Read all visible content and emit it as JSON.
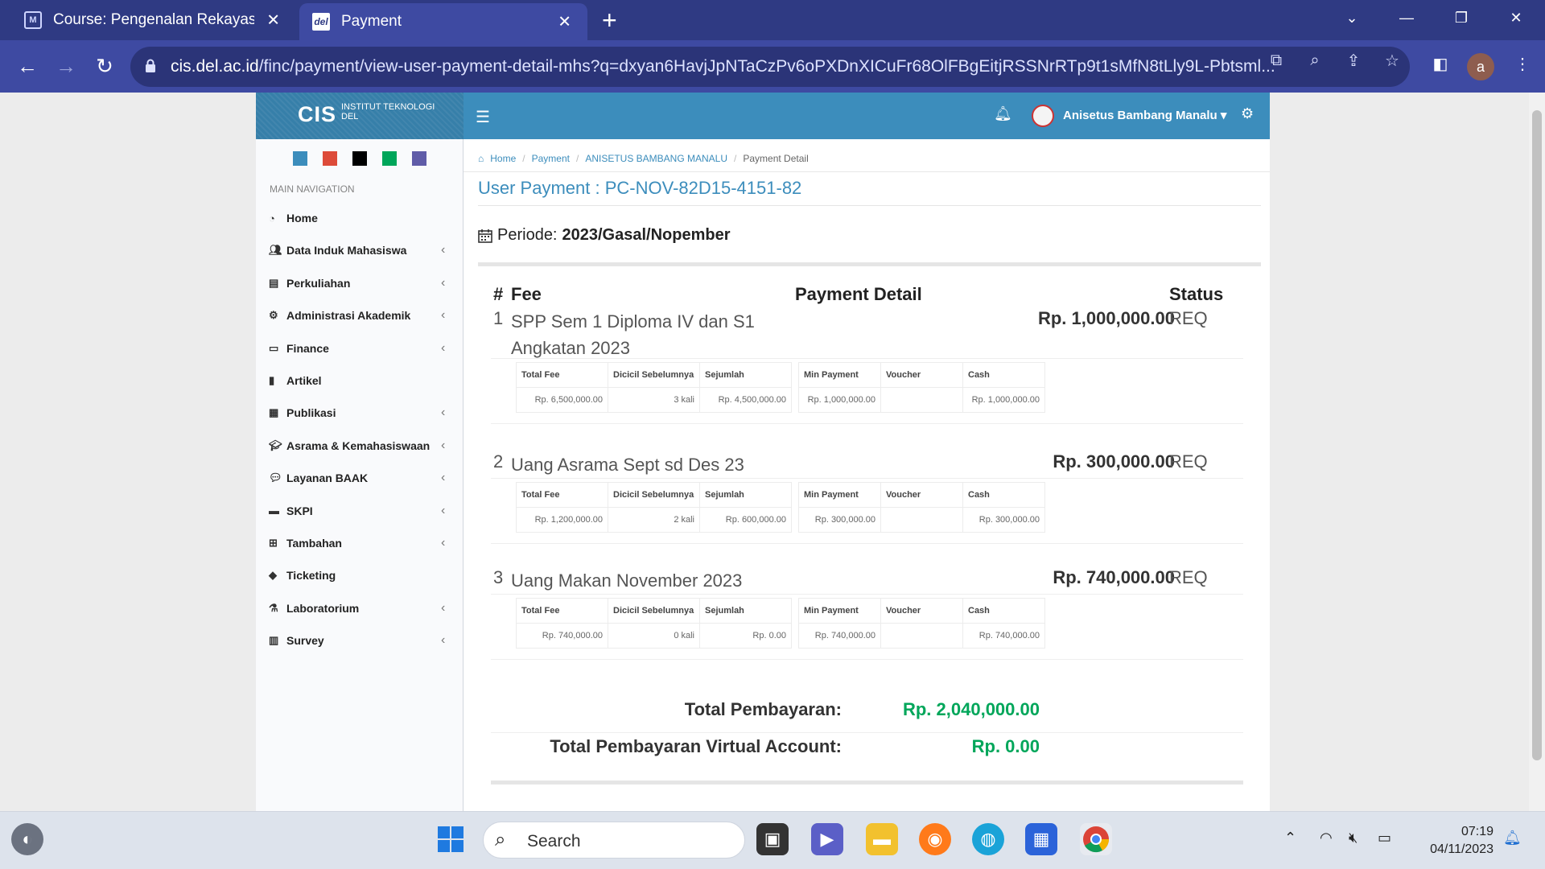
{
  "browser": {
    "tabs": [
      {
        "title": "Course: Pengenalan Rekayasa Pe",
        "icon": "moodle-icon"
      },
      {
        "title": "Payment",
        "icon": "del-icon"
      }
    ],
    "url_host": "cis.del.ac.id",
    "url_rest": "/finc/payment/view-user-payment-detail-mhs?q=dxyan6HavjJpNTaCzPv6oPXDnXICuFr68OlFBgEitjRSSNrRTp9t1sMfN8tLly9L-Pbtsml...",
    "profile_initial": "a"
  },
  "header": {
    "logo_main": "CIS",
    "logo_sub": "INSTITUT TEKNOLOGI DEL",
    "user_name": "Anisetus Bambang Manalu"
  },
  "sidebar": {
    "swatch_colors": [
      "#3c8dbc",
      "#dd4b39",
      "#000000",
      "#00a65a",
      "#605ca8"
    ],
    "nav_header": "MAIN NAVIGATION",
    "items": [
      {
        "label": "Home",
        "icon": "dashboard-icon",
        "expandable": false
      },
      {
        "label": "Data Induk Mahasiswa",
        "icon": "users-icon",
        "expandable": true
      },
      {
        "label": "Perkuliahan",
        "icon": "book-icon",
        "expandable": true
      },
      {
        "label": "Administrasi Akademik",
        "icon": "cogs-icon",
        "expandable": true
      },
      {
        "label": "Finance",
        "icon": "money-icon",
        "expandable": true
      },
      {
        "label": "Artikel",
        "icon": "file-icon",
        "expandable": false
      },
      {
        "label": "Publikasi",
        "icon": "newspaper-icon",
        "expandable": true
      },
      {
        "label": "Asrama & Kemahasiswaan",
        "icon": "graduation-cap-icon",
        "expandable": true
      },
      {
        "label": "Layanan BAAK",
        "icon": "comments-icon",
        "expandable": true
      },
      {
        "label": "SKPI",
        "icon": "archive-icon",
        "expandable": true
      },
      {
        "label": "Tambahan",
        "icon": "plus-square-icon",
        "expandable": true
      },
      {
        "label": "Ticketing",
        "icon": "tag-icon",
        "expandable": false
      },
      {
        "label": "Laboratorium",
        "icon": "flask-icon",
        "expandable": true
      },
      {
        "label": "Survey",
        "icon": "bar-chart-icon",
        "expandable": true
      }
    ]
  },
  "breadcrumb": [
    "Home",
    "Payment",
    "ANISETUS BAMBANG MANALU",
    "Payment Detail"
  ],
  "page": {
    "title": "User Payment : PC-NOV-82D15-4151-82",
    "periode_label": "Periode:",
    "periode_value": "2023/Gasal/Nopember",
    "headers": {
      "num": "#",
      "fee": "Fee",
      "detail": "Payment Detail",
      "status": "Status"
    },
    "mini_headers": [
      "Total Fee",
      "Dicicil Sebelumnya",
      "Sejumlah",
      "Min Payment",
      "Voucher",
      "Cash"
    ],
    "fees": [
      {
        "num": "1",
        "name": "SPP Sem 1 Diploma IV dan S1 Angkatan 2023",
        "amount": "Rp. 1,000,000.00",
        "status": "REQ",
        "total_fee": "Rp. 6,500,000.00",
        "dicicil": "3 kali",
        "sejumlah": "Rp. 4,500,000.00",
        "min_payment": "Rp. 1,000,000.00",
        "voucher": "",
        "cash": "Rp. 1,000,000.00"
      },
      {
        "num": "2",
        "name": "Uang Asrama Sept sd Des 23",
        "amount": "Rp. 300,000.00",
        "status": "REQ",
        "total_fee": "Rp. 1,200,000.00",
        "dicicil": "2 kali",
        "sejumlah": "Rp. 600,000.00",
        "min_payment": "Rp. 300,000.00",
        "voucher": "",
        "cash": "Rp. 300,000.00"
      },
      {
        "num": "3",
        "name": "Uang Makan November 2023",
        "amount": "Rp. 740,000.00",
        "status": "REQ",
        "total_fee": "Rp. 740,000.00",
        "dicicil": "0 kali",
        "sejumlah": "Rp. 0.00",
        "min_payment": "Rp. 740,000.00",
        "voucher": "",
        "cash": "Rp. 740,000.00"
      }
    ],
    "total_label": "Total Pembayaran:",
    "total_value": "Rp. 2,040,000.00",
    "total_va_label": "Total Pembayaran Virtual Account:",
    "total_va_value": "Rp. 0.00"
  },
  "taskbar": {
    "search_label": "Search",
    "time": "07:19",
    "date": "04/11/2023"
  }
}
